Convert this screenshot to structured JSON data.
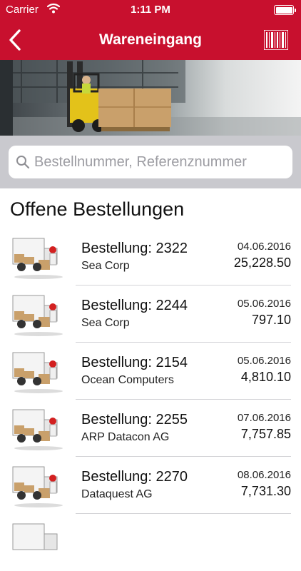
{
  "status_bar": {
    "carrier": "Carrier",
    "time": "1:11 PM"
  },
  "nav": {
    "title": "Wareneingang",
    "back_icon": "chevron-left-icon",
    "barcode_icon": "barcode-icon"
  },
  "hero": {
    "description_icon": "forklift-warehouse-image"
  },
  "search": {
    "placeholder": "Bestellnummer, Referenznummer",
    "value": ""
  },
  "section": {
    "title": "Offene Bestellungen"
  },
  "orders": [
    {
      "order": "Bestellung: 2322",
      "company": "Sea Corp",
      "date": "04.06.2016",
      "amount": "25,228.50"
    },
    {
      "order": "Bestellung: 2244",
      "company": "Sea Corp",
      "date": "05.06.2016",
      "amount": "797.10"
    },
    {
      "order": "Bestellung: 2154",
      "company": "Ocean Computers",
      "date": "05.06.2016",
      "amount": "4,810.10"
    },
    {
      "order": "Bestellung: 2255",
      "company": "ARP Datacon AG",
      "date": "07.06.2016",
      "amount": "7,757.85"
    },
    {
      "order": "Bestellung: 2270",
      "company": "Dataquest AG",
      "date": "08.06.2016",
      "amount": "7,731.30"
    }
  ],
  "colors": {
    "brand": "#c8102e",
    "search_bg": "#c9c9ce",
    "separator": "#d2d2d6"
  }
}
